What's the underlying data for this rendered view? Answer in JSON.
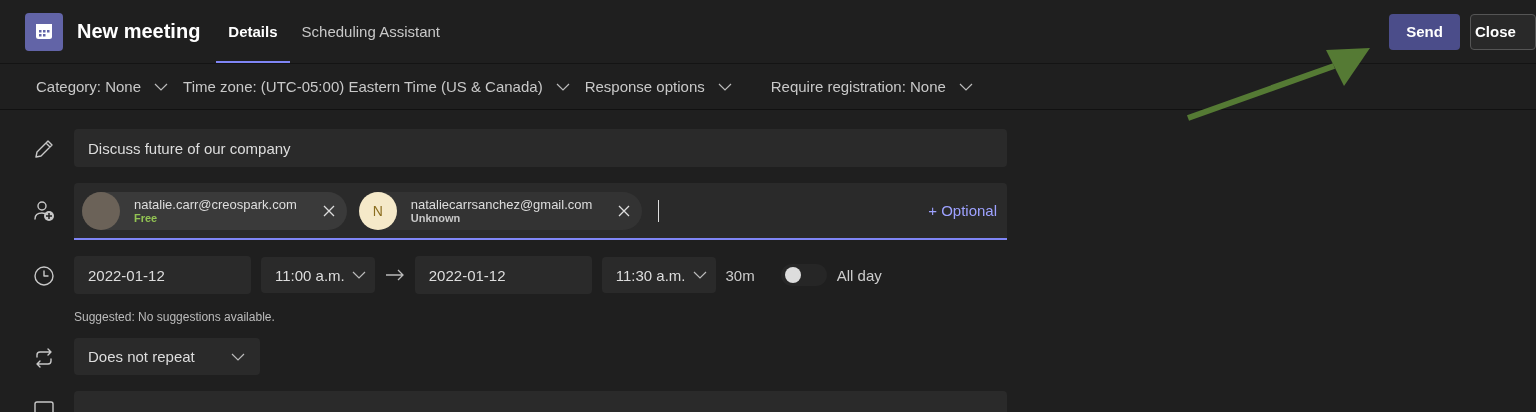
{
  "header": {
    "title": "New meeting",
    "tabs": [
      {
        "label": "Details",
        "selected": true
      },
      {
        "label": "Scheduling Assistant",
        "selected": false
      }
    ],
    "buttons": [
      {
        "label": "Send",
        "kind": "primary"
      },
      {
        "label": "Close",
        "kind": "secondary"
      }
    ]
  },
  "options": [
    {
      "label": "Category: None"
    },
    {
      "label": "Time zone: (UTC-05:00) Eastern Time (US & Canada)"
    },
    {
      "label": "Response options"
    },
    {
      "label": "Require registration: None"
    }
  ],
  "form": {
    "title": {
      "value": "Discuss future of our company"
    },
    "attendees": {
      "people": [
        {
          "email": "natalie.carr@creospark.com",
          "status": "Free",
          "color": "#92c353",
          "kind": "photo"
        },
        {
          "email": "nataliecarrsanchez@gmail.com",
          "status": "Unknown",
          "color": "#c8c8c8",
          "kind": "initial",
          "initial": "N"
        }
      ],
      "optional_link": "+ Optional"
    },
    "schedule": {
      "start_date": "2022-01-12",
      "start_time": "11:00 a.m.",
      "end_date": "2022-01-12",
      "end_time": "11:30 a.m.",
      "duration": "30m",
      "all_day": {
        "label": "All day",
        "on": false
      },
      "suggestion": "Suggested: No suggestions available."
    },
    "repeat": {
      "value": "Does not repeat"
    }
  }
}
